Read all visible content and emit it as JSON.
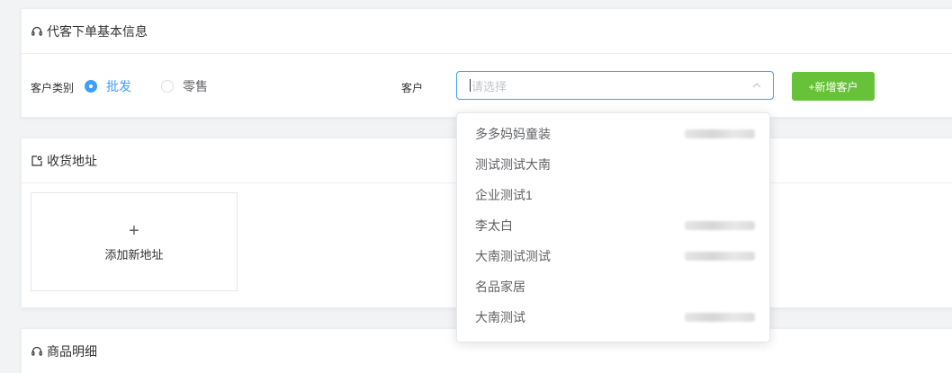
{
  "basic_info": {
    "title": "代客下单基本信息",
    "customer_type_label": "客户类别",
    "radio_options": [
      {
        "label": "批发",
        "checked": true
      },
      {
        "label": "零售",
        "checked": false
      }
    ],
    "customer_label": "客户",
    "customer_select": {
      "placeholder": "请选择",
      "value": ""
    },
    "add_customer_button": "+新增客户"
  },
  "address": {
    "title": "收货地址",
    "add_new_label": "添加新地址"
  },
  "goods": {
    "title": "商品明细"
  },
  "customer_dropdown": {
    "options": [
      {
        "name": "多多妈妈童装",
        "phone_redacted": true
      },
      {
        "name": "测试测试大南",
        "phone_redacted": false
      },
      {
        "name": "企业测试1",
        "phone_redacted": false
      },
      {
        "name": "李太白",
        "phone_redacted": true
      },
      {
        "name": "大南测试测试",
        "phone_redacted": true
      },
      {
        "name": "名品家居",
        "phone_redacted": false
      },
      {
        "name": "大南测试",
        "phone_redacted": true
      },
      {
        "name": "",
        "phone_redacted": true
      }
    ]
  },
  "colors": {
    "primary": "#409eff",
    "success": "#67c23a",
    "border": "#ebeef5",
    "background": "#f2f3f5"
  }
}
